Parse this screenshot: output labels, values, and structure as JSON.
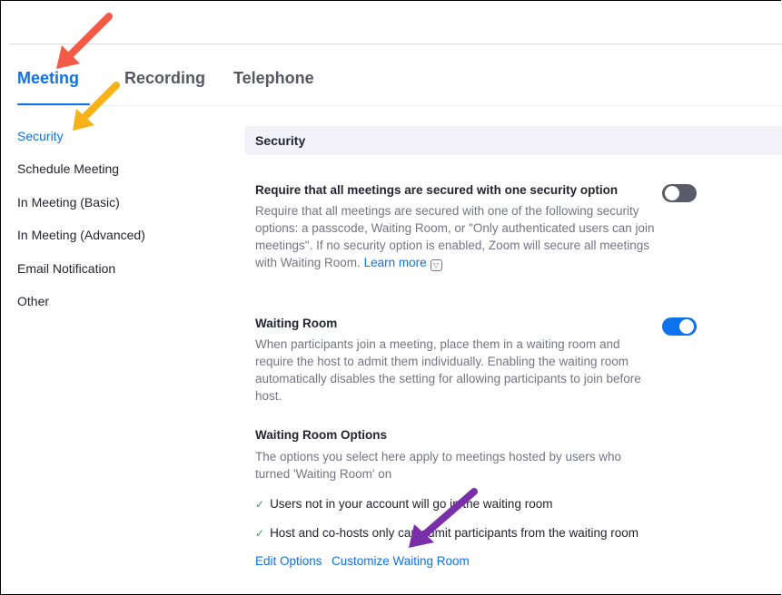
{
  "tabs": [
    {
      "label": "Meeting",
      "active": true
    },
    {
      "label": "Recording",
      "active": false
    },
    {
      "label": "Telephone",
      "active": false
    }
  ],
  "sidebar": {
    "items": [
      {
        "label": "Security",
        "active": true
      },
      {
        "label": "Schedule Meeting",
        "active": false
      },
      {
        "label": "In Meeting (Basic)",
        "active": false
      },
      {
        "label": "In Meeting (Advanced)",
        "active": false
      },
      {
        "label": "Email Notification",
        "active": false
      },
      {
        "label": "Other",
        "active": false
      }
    ]
  },
  "section": {
    "title": "Security"
  },
  "settings": {
    "require_security": {
      "title": "Require that all meetings are secured with one security option",
      "description": "Require that all meetings are secured with one of the following security options: a passcode, Waiting Room, or \"Only authenticated users can join meetings\". If no security option is enabled, Zoom will secure all meetings with Waiting Room.",
      "learn_more": "Learn more",
      "ext_icon": "external-link-icon",
      "enabled": false
    },
    "waiting_room": {
      "title": "Waiting Room",
      "description": "When participants join a meeting, place them in a waiting room and require the host to admit them individually. Enabling the waiting room automatically disables the setting for allowing participants to join before host.",
      "enabled": true
    },
    "waiting_room_options": {
      "title": "Waiting Room Options",
      "description": "The options you select here apply to meetings hosted by users who turned 'Waiting Room' on",
      "items": [
        "Users not in your account will go in the waiting room",
        "Host and co-hosts only can admit participants from the waiting room"
      ],
      "edit_options": "Edit Options",
      "customize": "Customize Waiting Room"
    }
  },
  "colors": {
    "accent": "#0e72ed",
    "toggle_off": "#5a5a68",
    "arrow_red": "#f05a46",
    "arrow_orange": "#f5b21a",
    "arrow_purple": "#7a2fa8"
  },
  "icons": {
    "check": "checkmark-icon"
  }
}
